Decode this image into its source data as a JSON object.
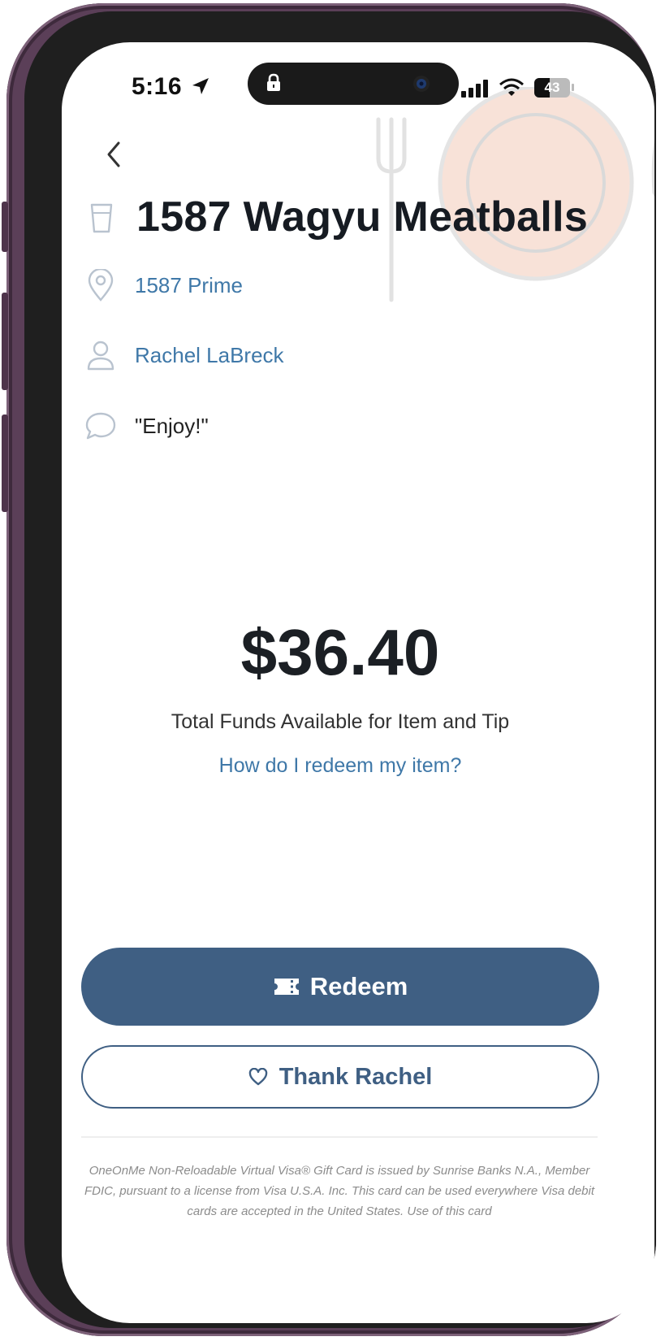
{
  "status_bar": {
    "time": "5:16",
    "battery": "43"
  },
  "header": {
    "back_icon": "chevron-left-icon"
  },
  "item": {
    "title": "1587 Wagyu Meatballs",
    "title_icon": "cup-icon"
  },
  "details": {
    "location": {
      "icon": "location-pin-icon",
      "text": "1587 Prime"
    },
    "sender": {
      "icon": "person-icon",
      "text": "Rachel LaBreck"
    },
    "message": {
      "icon": "chat-bubble-icon",
      "text": "\"Enjoy!\""
    }
  },
  "funds": {
    "amount": "$36.40",
    "label": "Total Funds Available for Item and Tip",
    "help_link": "How do I redeem my item?"
  },
  "actions": {
    "redeem_label": "Redeem",
    "redeem_icon": "ticket-icon",
    "thank_label": "Thank Rachel",
    "thank_icon": "heart-icon"
  },
  "footer": {
    "disclaimer": "OneOnMe Non-Reloadable Virtual Visa® Gift Card is issued by Sunrise Banks N.A., Member FDIC, pursuant to a license from Visa U.S.A. Inc. This card can be used everywhere Visa debit cards are accepted in the United States. Use of this card"
  },
  "colors": {
    "accent": "#3f5f83",
    "link": "#3f78a8",
    "frame": "#5b3f58"
  }
}
